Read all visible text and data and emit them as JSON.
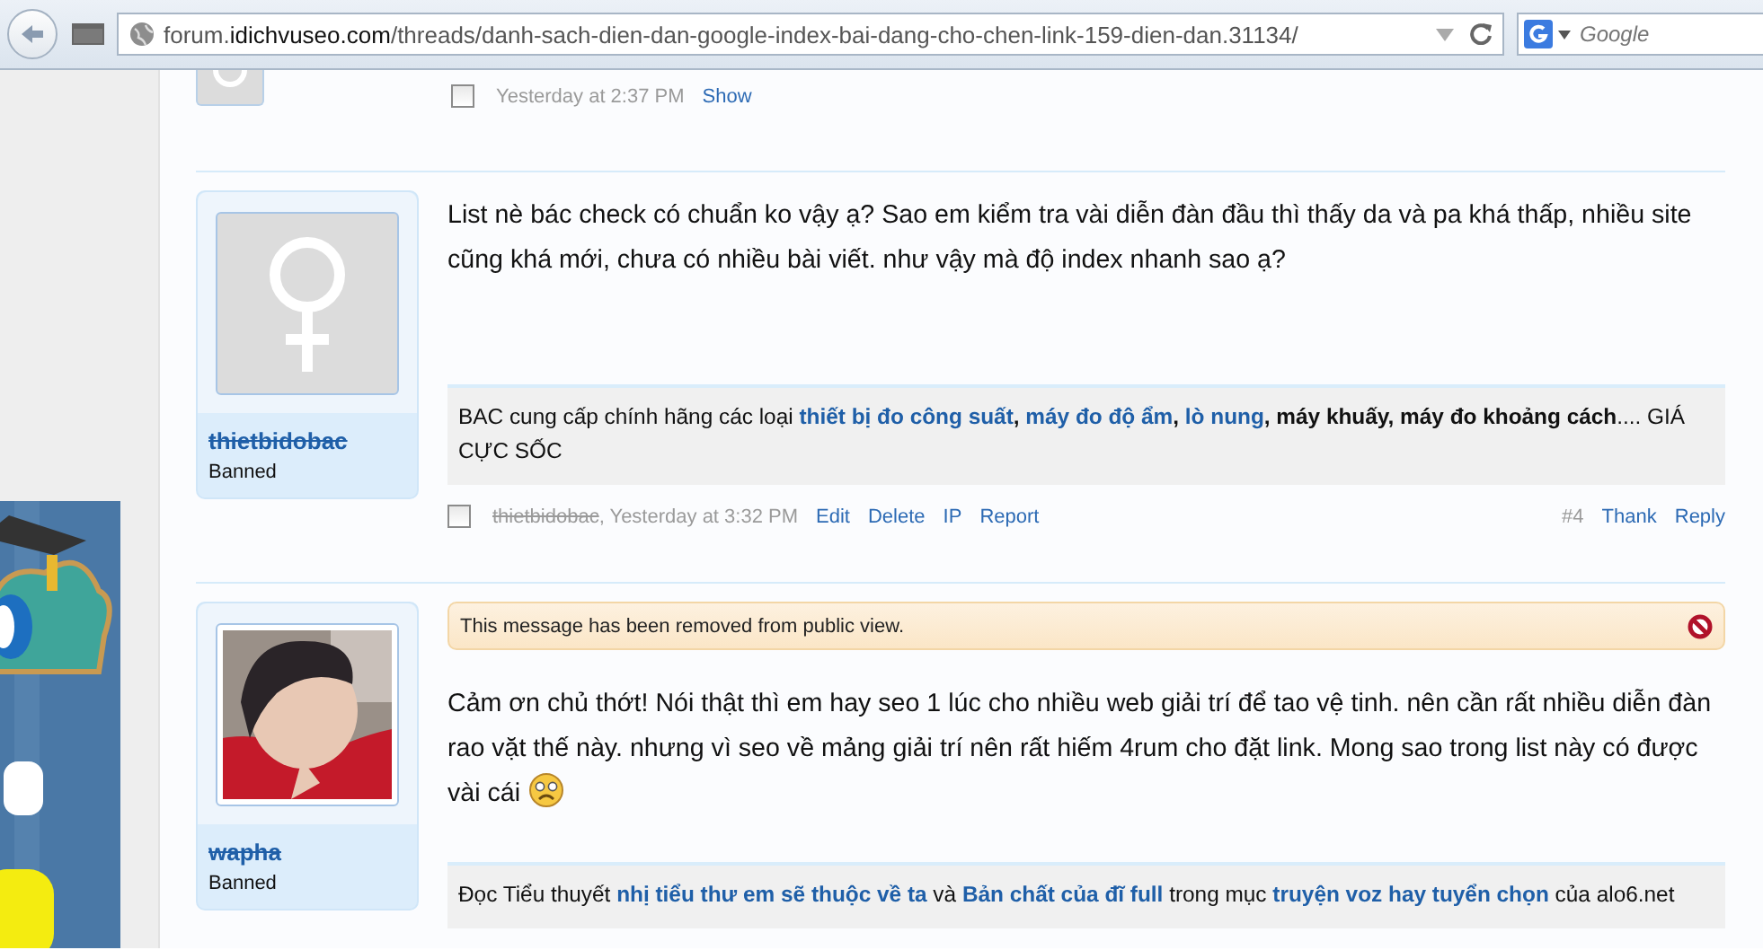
{
  "browser": {
    "url": [
      {
        "text": "forum.",
        "kind": "dim"
      },
      {
        "text": "idichvuseo.com",
        "kind": "host"
      },
      {
        "text": "/threads/danh-sach-dien-dan-google-index-bai-dang-cho-chen-link-159-dien-dan.31134/",
        "kind": "dim"
      }
    ],
    "search": {
      "placeholder": "Google"
    }
  },
  "previous_post": {
    "checked": false,
    "time": "Yesterday at 2:37 PM",
    "actions": [
      "Show"
    ]
  },
  "posts": [
    {
      "user": {
        "name": "thietbidobac",
        "title": "Banned",
        "banned": true,
        "avatar": {
          "kind": "default"
        }
      },
      "message": [
        {
          "kind": "text",
          "text": "List nè bác check có chuẩn ko vậy ạ? Sao em kiểm tra vài diễn đàn đầu thì thấy da và pa khá thấp, nhiều site cũng khá mới, chưa có nhiều bài viết. như vậy mà độ index nhanh sao ạ?"
        }
      ],
      "signature": [
        {
          "text": "BAC cung cấp chính hãng các loại ",
          "kind": "text"
        },
        {
          "text": "thiết bị đo công suất",
          "kind": "link"
        },
        {
          "text": ", ",
          "kind": "bold"
        },
        {
          "text": "máy đo độ ẩm",
          "kind": "link"
        },
        {
          "text": ", ",
          "kind": "bold"
        },
        {
          "text": "lò nung",
          "kind": "link"
        },
        {
          "text": ", máy khuấy, máy đo khoảng cách",
          "kind": "bold"
        },
        {
          "text": ".... GIÁ CỰC SỐC",
          "kind": "text"
        }
      ],
      "meta": {
        "checked": false,
        "author": "thietbidobac",
        "time": ", Yesterday at 3:32 PM",
        "actions": [
          "Edit",
          "Delete",
          "IP",
          "Report"
        ],
        "number": "#4",
        "right_actions": [
          "Thank",
          "Reply"
        ]
      }
    },
    {
      "user": {
        "name": "wapha",
        "title": "Banned",
        "banned": true
      },
      "notice": "This message has been removed from public view.",
      "message": [
        {
          "kind": "text",
          "text": "Cảm ơn chủ thớt! Nói thật thì em hay seo 1 lúc cho nhiều web giải trí để tao vệ tinh. nên cần rất nhiều diễn đàn rao vặt thế này. nhưng vì seo về mảng giải trí nên rất hiếm 4rum cho đặt link. Mong sao trong list này có được vài cái "
        },
        {
          "kind": "emoticon"
        }
      ],
      "signature": [
        {
          "text": "Đọc Tiểu thuyết ",
          "kind": "text"
        },
        {
          "text": "nhị tiểu thư em sẽ thuộc về ta",
          "kind": "link"
        },
        {
          "text": " và ",
          "kind": "text"
        },
        {
          "text": "Bản chất của đĩ full",
          "kind": "link"
        },
        {
          "text": " trong mục ",
          "kind": "text"
        },
        {
          "text": "truyện voz hay tuyển chọn",
          "kind": "link"
        },
        {
          "text": " của alo6.net",
          "kind": "text"
        }
      ]
    }
  ]
}
